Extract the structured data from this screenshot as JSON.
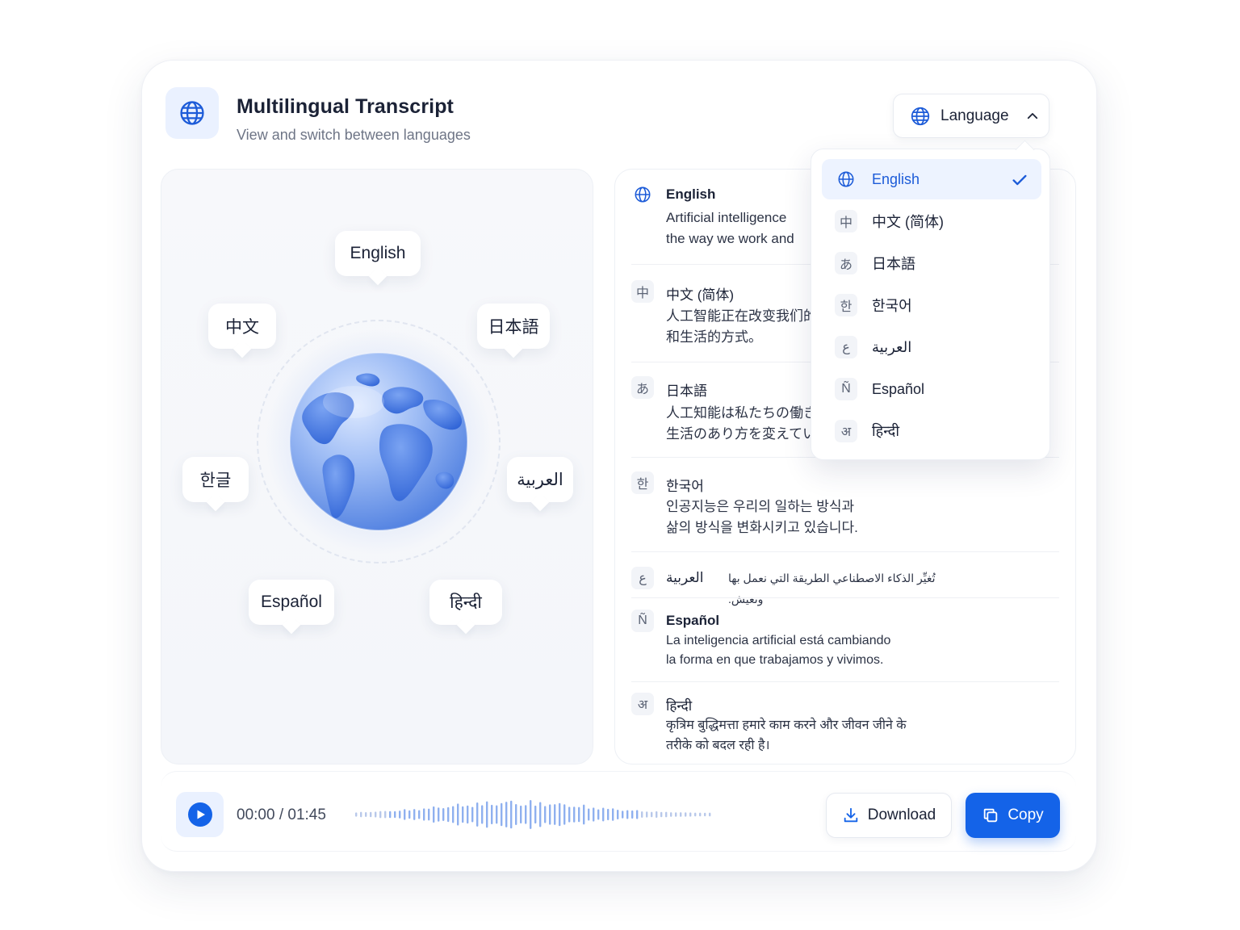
{
  "header": {
    "title": "Multilingual Transcript",
    "subtitle": "View and switch between languages",
    "icon": "globe-icon"
  },
  "language_button": {
    "label": "Language",
    "icon": "globe-icon",
    "state_icon": "chevron-up-icon"
  },
  "globe_bubbles": [
    {
      "label": "English"
    },
    {
      "label": "中文"
    },
    {
      "label": "日本語"
    },
    {
      "label": "한글"
    },
    {
      "label": "العربية"
    },
    {
      "label": "Español"
    },
    {
      "label": "हिन्दी"
    }
  ],
  "transcript": [
    {
      "icon_glyph": "",
      "icon": "globe-icon",
      "name": "English",
      "text": "Artificial intelligence\nthe way we work and"
    },
    {
      "icon_glyph": "中",
      "name": "中文 (简体)",
      "text": "人工智能正在改变我们的\n和生活的方式。"
    },
    {
      "icon_glyph": "あ",
      "name": "日本語",
      "text": "人工知能は私たちの働き方\n生活のあり方を変えていま"
    },
    {
      "icon_glyph": "한",
      "name": "한국어",
      "text": "인공지능은 우리의 일하는 방식과\n삶의 방식을 변화시키고 있습니다."
    },
    {
      "icon_glyph": "ع",
      "name": "العربية",
      "text": "تُغيِّر الذكاء الاصطناعي الطريقة التي نعمل بها ونعيش."
    },
    {
      "icon_glyph": "Ñ",
      "name": "Español",
      "text": "La inteligencia artificial está cambiando\nla forma en que trabajamos y vivimos."
    },
    {
      "icon_glyph": "अ",
      "name": "हिन्दी",
      "text": "कृत्रिम बुद्धिमत्ता हमारे काम करने और जीवन जीने के\nतरीके को बदल रही है।"
    }
  ],
  "language_menu": {
    "selected": "English",
    "items": [
      {
        "glyph": "",
        "icon": "globe-icon",
        "label": "English",
        "selected": true
      },
      {
        "glyph": "中",
        "label": "中文 (简体)"
      },
      {
        "glyph": "あ",
        "label": "日本語"
      },
      {
        "glyph": "한",
        "label": "한국어"
      },
      {
        "glyph": "ع",
        "label": "العربية"
      },
      {
        "glyph": "Ñ",
        "label": "Español"
      },
      {
        "glyph": "अ",
        "label": "हिन्दी"
      }
    ]
  },
  "player": {
    "time": "00:00 / 01:45",
    "progress": 0,
    "play_icon": "play-icon"
  },
  "actions": {
    "download_label": "Download",
    "download_icon": "download-icon",
    "copy_label": "Copy",
    "copy_icon": "copy-icon"
  },
  "colors": {
    "accent": "#1463e8",
    "accent_soft": "#eaf1ff",
    "text": "#1b2236",
    "muted": "#6e7586"
  }
}
